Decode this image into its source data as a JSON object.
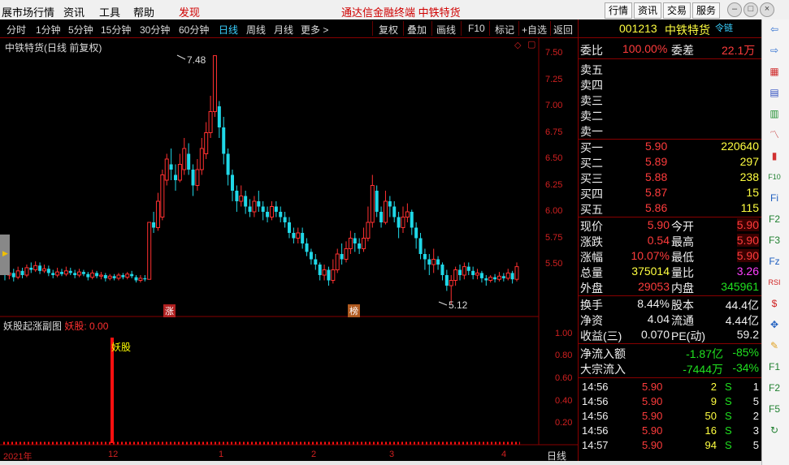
{
  "topbar": {
    "menus": [
      "展市场行情",
      "资讯",
      "工具",
      "帮助",
      "发现"
    ],
    "title": "通达信金融终端   中铁特货",
    "buttons": [
      "行情",
      "资讯",
      "交易",
      "服务"
    ]
  },
  "tabs": [
    "分时",
    "1分钟",
    "5分钟",
    "15分钟",
    "30分钟",
    "60分钟",
    "日线",
    "周线",
    "月线",
    "更多 >"
  ],
  "tools": [
    "复权",
    "叠加",
    "画线",
    "F10",
    "标记",
    "+自选",
    "返回"
  ],
  "chart": {
    "title": "中铁特货(日线 前复权)",
    "high_label": "7.48",
    "low_label": "5.12",
    "zhang": "涨",
    "bang": "榜",
    "y_ticks": [
      "7.50",
      "7.25",
      "7.00",
      "6.75",
      "6.50",
      "6.25",
      "6.00",
      "5.75",
      "5.50"
    ],
    "candles": [
      [
        5.45,
        5.4,
        5.5,
        5.35
      ],
      [
        5.4,
        5.42,
        5.48,
        5.36
      ],
      [
        5.42,
        5.38,
        5.46,
        5.34
      ],
      [
        5.38,
        5.44,
        5.48,
        5.36
      ],
      [
        5.44,
        5.4,
        5.47,
        5.37
      ],
      [
        5.4,
        5.47,
        5.5,
        5.38
      ],
      [
        5.47,
        5.45,
        5.52,
        5.42
      ],
      [
        5.45,
        5.49,
        5.53,
        5.43
      ],
      [
        5.49,
        5.44,
        5.52,
        5.41
      ],
      [
        5.44,
        5.46,
        5.5,
        5.42
      ],
      [
        5.46,
        5.42,
        5.49,
        5.39
      ],
      [
        5.42,
        5.4,
        5.45,
        5.37
      ],
      [
        5.4,
        5.43,
        5.47,
        5.38
      ],
      [
        5.43,
        5.41,
        5.46,
        5.39
      ],
      [
        5.41,
        5.44,
        5.48,
        5.39
      ],
      [
        5.44,
        5.42,
        5.47,
        5.4
      ],
      [
        5.42,
        5.4,
        5.45,
        5.37
      ],
      [
        5.4,
        5.43,
        5.46,
        5.38
      ],
      [
        5.43,
        5.41,
        5.45,
        5.39
      ],
      [
        5.41,
        5.38,
        5.43,
        5.35
      ],
      [
        5.38,
        5.42,
        5.45,
        5.36
      ],
      [
        5.42,
        5.39,
        5.44,
        5.37
      ],
      [
        5.39,
        5.4,
        5.43,
        5.36
      ],
      [
        5.4,
        5.37,
        5.42,
        5.34
      ],
      [
        5.37,
        5.39,
        5.41,
        5.35
      ],
      [
        5.39,
        5.37,
        5.41,
        5.35
      ],
      [
        5.37,
        5.4,
        5.42,
        5.35
      ],
      [
        5.4,
        5.38,
        5.42,
        5.36
      ],
      [
        5.38,
        5.41,
        5.43,
        5.36
      ],
      [
        5.41,
        5.39,
        5.44,
        5.37
      ],
      [
        5.38,
        5.35,
        5.4,
        5.33
      ],
      [
        5.35,
        5.37,
        5.4,
        5.33
      ],
      [
        5.37,
        5.36,
        5.4,
        5.34
      ],
      [
        5.36,
        5.9,
        5.9,
        5.36
      ],
      [
        5.9,
        5.85,
        6.0,
        5.8
      ],
      [
        5.85,
        6.1,
        6.18,
        5.82
      ],
      [
        5.95,
        6.35,
        6.4,
        5.92
      ],
      [
        6.3,
        6.5,
        6.55,
        6.25
      ],
      [
        6.45,
        6.4,
        6.6,
        6.3
      ],
      [
        6.35,
        6.3,
        6.45,
        6.2
      ],
      [
        6.3,
        6.45,
        6.55,
        6.28
      ],
      [
        6.4,
        6.6,
        6.7,
        6.35
      ],
      [
        6.55,
        6.4,
        6.65,
        6.35
      ],
      [
        6.4,
        6.25,
        6.45,
        6.15
      ],
      [
        6.25,
        6.4,
        6.5,
        6.2
      ],
      [
        6.4,
        6.6,
        6.7,
        6.35
      ],
      [
        6.55,
        6.75,
        6.85,
        6.5
      ],
      [
        6.75,
        6.95,
        7.1,
        6.7
      ],
      [
        6.95,
        7.48,
        7.48,
        6.9
      ],
      [
        7.0,
        6.8,
        7.05,
        6.7
      ],
      [
        6.8,
        6.55,
        6.9,
        6.45
      ],
      [
        6.55,
        6.35,
        6.6,
        6.25
      ],
      [
        6.35,
        6.2,
        6.4,
        6.1
      ],
      [
        6.2,
        6.1,
        6.25,
        6.0
      ],
      [
        6.1,
        6.15,
        6.25,
        6.05
      ],
      [
        6.15,
        6.05,
        6.2,
        5.98
      ],
      [
        6.05,
        6.0,
        6.12,
        5.95
      ],
      [
        6.0,
        6.1,
        6.15,
        5.95
      ],
      [
        6.1,
        6.05,
        6.2,
        6.0
      ],
      [
        6.05,
        6.0,
        6.1,
        5.92
      ],
      [
        6.0,
        5.95,
        6.05,
        5.9
      ],
      [
        5.95,
        6.05,
        6.1,
        5.92
      ],
      [
        6.05,
        6.0,
        6.1,
        5.95
      ],
      [
        6.0,
        5.95,
        6.05,
        5.9
      ],
      [
        5.95,
        5.9,
        6.0,
        5.85
      ],
      [
        5.9,
        5.8,
        5.95,
        5.75
      ],
      [
        5.8,
        5.75,
        5.85,
        5.7
      ],
      [
        5.75,
        5.8,
        5.85,
        5.7
      ],
      [
        5.8,
        5.7,
        5.85,
        5.65
      ],
      [
        5.7,
        5.62,
        5.75,
        5.58
      ],
      [
        5.62,
        5.55,
        5.65,
        5.5
      ],
      [
        5.55,
        5.5,
        5.6,
        5.45
      ],
      [
        5.5,
        5.4,
        5.52,
        5.35
      ],
      [
        5.4,
        5.45,
        5.5,
        5.35
      ],
      [
        5.45,
        5.35,
        5.48,
        5.3
      ],
      [
        5.35,
        5.45,
        5.55,
        5.32
      ],
      [
        5.45,
        5.6,
        5.65,
        5.42
      ],
      [
        5.6,
        5.55,
        5.7,
        5.5
      ],
      [
        5.55,
        5.65,
        5.72,
        5.52
      ],
      [
        5.65,
        5.75,
        5.82,
        5.6
      ],
      [
        5.75,
        5.7,
        5.8,
        5.62
      ],
      [
        5.7,
        5.65,
        5.75,
        5.6
      ],
      [
        5.65,
        5.75,
        5.85,
        5.62
      ],
      [
        5.75,
        5.9,
        6.05,
        5.72
      ],
      [
        5.9,
        6.25,
        6.35,
        5.85
      ],
      [
        6.2,
        6.0,
        6.25,
        5.95
      ],
      [
        6.0,
        5.9,
        6.05,
        5.85
      ],
      [
        5.9,
        6.1,
        6.2,
        5.88
      ],
      [
        6.1,
        6.05,
        6.15,
        5.95
      ],
      [
        6.05,
        5.95,
        6.1,
        5.9
      ],
      [
        5.95,
        5.85,
        6.0,
        5.75
      ],
      [
        5.85,
        5.95,
        6.05,
        5.8
      ],
      [
        5.95,
        6.0,
        6.08,
        5.9
      ],
      [
        6.0,
        5.85,
        6.02,
        5.78
      ],
      [
        5.85,
        5.75,
        5.9,
        5.65
      ],
      [
        5.75,
        5.6,
        5.8,
        5.55
      ],
      [
        5.6,
        5.55,
        5.65,
        5.45
      ],
      [
        5.55,
        5.5,
        5.6,
        5.4
      ],
      [
        5.5,
        5.55,
        5.65,
        5.42
      ],
      [
        5.55,
        5.5,
        5.58,
        5.45
      ],
      [
        5.5,
        5.4,
        5.52,
        5.35
      ],
      [
        5.4,
        5.3,
        5.45,
        5.25
      ],
      [
        5.3,
        5.35,
        5.4,
        5.12
      ],
      [
        5.35,
        5.45,
        5.48,
        5.3
      ],
      [
        5.45,
        5.4,
        5.5,
        5.35
      ],
      [
        5.4,
        5.48,
        5.52,
        5.36
      ],
      [
        5.48,
        5.44,
        5.52,
        5.4
      ],
      [
        5.44,
        5.4,
        5.48,
        5.36
      ],
      [
        5.4,
        5.42,
        5.46,
        5.36
      ],
      [
        5.42,
        5.37,
        5.44,
        5.33
      ],
      [
        5.37,
        5.35,
        5.4,
        5.3
      ],
      [
        5.35,
        5.38,
        5.4,
        5.33
      ],
      [
        5.38,
        5.36,
        5.41,
        5.33
      ],
      [
        5.36,
        5.39,
        5.43,
        5.34
      ],
      [
        5.39,
        5.37,
        5.42,
        5.34
      ],
      [
        5.37,
        5.42,
        5.46,
        5.35
      ],
      [
        5.42,
        5.36,
        5.44,
        5.32
      ],
      [
        5.36,
        5.48,
        5.52,
        5.34
      ]
    ],
    "date_labels": [
      "2021年",
      "12",
      "1",
      "2",
      "3",
      "4"
    ],
    "period_label": "日线"
  },
  "indicator": {
    "title": "妖股起涨副图",
    "value_label": "妖股: 0.00",
    "signal": "妖股",
    "y_ticks": [
      "1.00",
      "0.80",
      "0.60",
      "0.40",
      "0.20"
    ]
  },
  "quote": {
    "code": "001213",
    "name": "中铁特货",
    "chain": "令链",
    "weibi_label": "委比",
    "weibi": "100.00%",
    "weicha_label": "委差",
    "weicha": "22.1万",
    "sell": [
      {
        "label": "卖五"
      },
      {
        "label": "卖四"
      },
      {
        "label": "卖三"
      },
      {
        "label": "卖二"
      },
      {
        "label": "卖一"
      }
    ],
    "buy": [
      {
        "label": "买一",
        "price": "5.90",
        "vol": "220640"
      },
      {
        "label": "买二",
        "price": "5.89",
        "vol": "297"
      },
      {
        "label": "买三",
        "price": "5.88",
        "vol": "238"
      },
      {
        "label": "买四",
        "price": "5.87",
        "vol": "15"
      },
      {
        "label": "买五",
        "price": "5.86",
        "vol": "115"
      }
    ],
    "stats": [
      {
        "l1": "现价",
        "v1": "5.90",
        "l2": "今开",
        "v2": "5.90"
      },
      {
        "l1": "涨跌",
        "v1": "0.54",
        "l2": "最高",
        "v2": "5.90"
      },
      {
        "l1": "涨幅",
        "v1": "10.07%",
        "l2": "最低",
        "v2": "5.90"
      },
      {
        "l1": "总量",
        "v1": "375014",
        "l2": "量比",
        "v2": "3.26"
      },
      {
        "l1": "外盘",
        "v1": "29053",
        "l2": "内盘",
        "v2": "345961"
      }
    ],
    "info": [
      {
        "l1": "换手",
        "v1": "8.44%",
        "l2": "股本",
        "v2": "44.4亿"
      },
      {
        "l1": "净资",
        "v1": "4.04",
        "l2": "流通",
        "v2": "4.44亿"
      },
      {
        "l1": "收益(三)",
        "v1": "0.070",
        "l2": "PE(动)",
        "v2": "59.2"
      }
    ],
    "flows": [
      {
        "label": "净流入额",
        "v1": "-1.87亿",
        "v2": "-85%"
      },
      {
        "label": "大宗流入",
        "v1": "-7444万",
        "v2": "-34%"
      }
    ],
    "trades": [
      {
        "time": "14:56",
        "price": "5.90",
        "vol": "2",
        "side": "S",
        "n": "1"
      },
      {
        "time": "14:56",
        "price": "5.90",
        "vol": "9",
        "side": "S",
        "n": "5"
      },
      {
        "time": "14:56",
        "price": "5.90",
        "vol": "50",
        "side": "S",
        "n": "2"
      },
      {
        "time": "14:56",
        "price": "5.90",
        "vol": "16",
        "side": "S",
        "n": "3"
      },
      {
        "time": "14:57",
        "price": "5.90",
        "vol": "94",
        "side": "S",
        "n": "5"
      }
    ]
  },
  "sidebar": [
    "arrow-left",
    "arrow-right",
    "grid",
    "table",
    "table2",
    "chart",
    "candles",
    "F10",
    "Fi",
    "F2",
    "F3",
    "Fiz",
    "RSI",
    "dollar",
    "move",
    "pencil",
    "F1",
    "F2b",
    "F5",
    "refresh"
  ]
}
